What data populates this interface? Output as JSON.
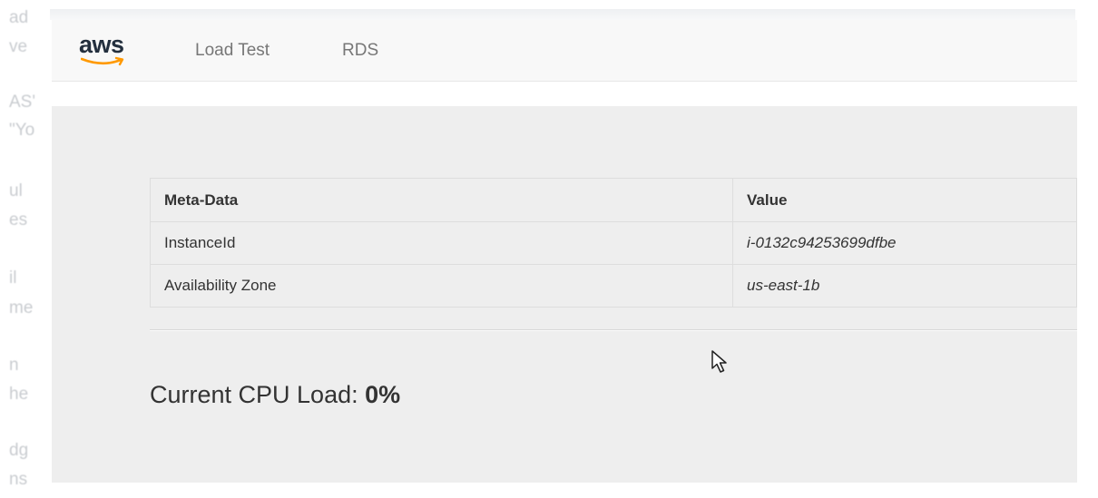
{
  "bg_fragments": [
    "ad",
    "ve",
    "AS'",
    "\"Yo",
    "ul",
    "es",
    "il",
    "me",
    "n",
    "he",
    "dg",
    "ns"
  ],
  "navbar": {
    "brand": "aws",
    "links": [
      {
        "label": "Load Test"
      },
      {
        "label": "RDS"
      }
    ]
  },
  "table": {
    "headers": [
      "Meta-Data",
      "Value"
    ],
    "rows": [
      {
        "key": "InstanceId",
        "value": "i-0132c94253699dfbe"
      },
      {
        "key": "Availability Zone",
        "value": "us-east-1b"
      }
    ]
  },
  "cpu": {
    "label": "Current CPU Load: ",
    "value": "0%"
  },
  "colors": {
    "brand_text": "#232f3e",
    "brand_smile": "#ff9900",
    "navbar_bg": "#f8f8f8",
    "panel_bg": "#eeeeee"
  }
}
